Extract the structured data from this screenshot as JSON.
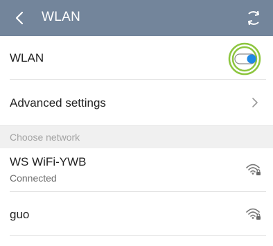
{
  "header": {
    "title": "WLAN",
    "background": "#73859b"
  },
  "wlan_toggle": {
    "label": "WLAN",
    "state": "on",
    "accent": "#1e88e5",
    "highlight": "#8dc63f"
  },
  "advanced": {
    "label": "Advanced settings"
  },
  "section": {
    "label": "Choose network"
  },
  "networks": [
    {
      "name": "WS WiFi-YWB",
      "status": "Connected",
      "icon": "wifi-lock-icon"
    },
    {
      "name": "guo",
      "status": "",
      "icon": "wifi-lock-icon"
    }
  ]
}
